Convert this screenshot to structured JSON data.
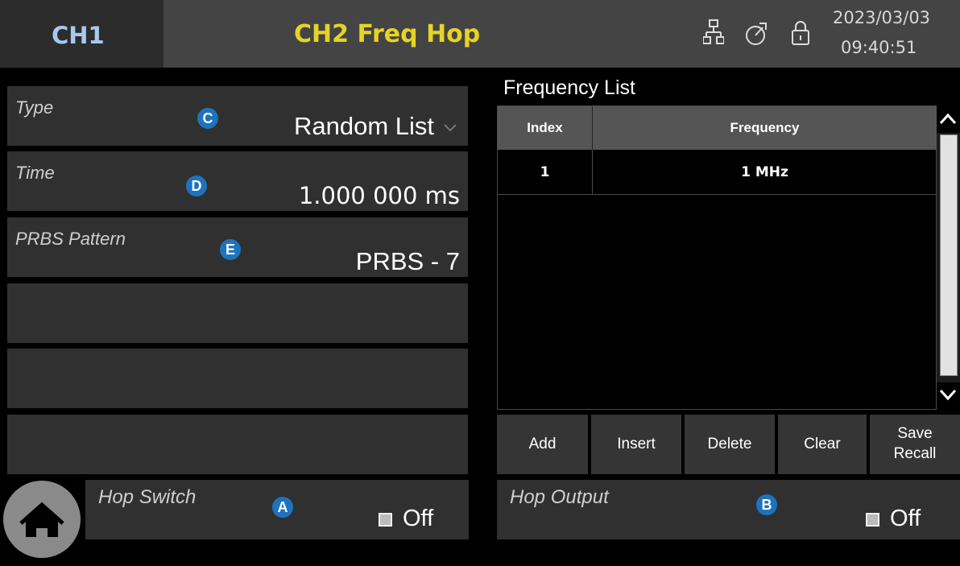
{
  "header": {
    "ch1_tab": "CH1",
    "ch2_tab": "CH2 Freq Hop",
    "date": "2023/03/03",
    "time": "09:40:51"
  },
  "params": {
    "type_label": "Type",
    "type_value": "Random List",
    "time_label": "Time",
    "time_value": "1.000 000 ms",
    "prbs_label": "PRBS Pattern",
    "prbs_value": "PRBS - 7"
  },
  "markers": {
    "a": "A",
    "b": "B",
    "c": "C",
    "d": "D",
    "e": "E"
  },
  "frequency_list": {
    "title": "Frequency List",
    "columns": [
      "Index",
      "Frequency"
    ],
    "rows": [
      {
        "index": "1",
        "frequency": "1 MHz"
      }
    ]
  },
  "actions": {
    "add": "Add",
    "insert": "Insert",
    "delete": "Delete",
    "clear": "Clear",
    "save": "Save",
    "recall": "Recall"
  },
  "bottom": {
    "hop_switch_label": "Hop Switch",
    "hop_switch_value": "Off",
    "hop_output_label": "Hop Output",
    "hop_output_value": "Off"
  },
  "colors": {
    "ch1_accent": "#a8c8ee",
    "ch2_accent": "#e6d325",
    "marker": "#1e73be"
  },
  "icons": [
    "network-icon",
    "timer-icon",
    "lock-icon",
    "home-icon",
    "chevron-down-icon",
    "scroll-up-icon",
    "scroll-down-icon"
  ]
}
